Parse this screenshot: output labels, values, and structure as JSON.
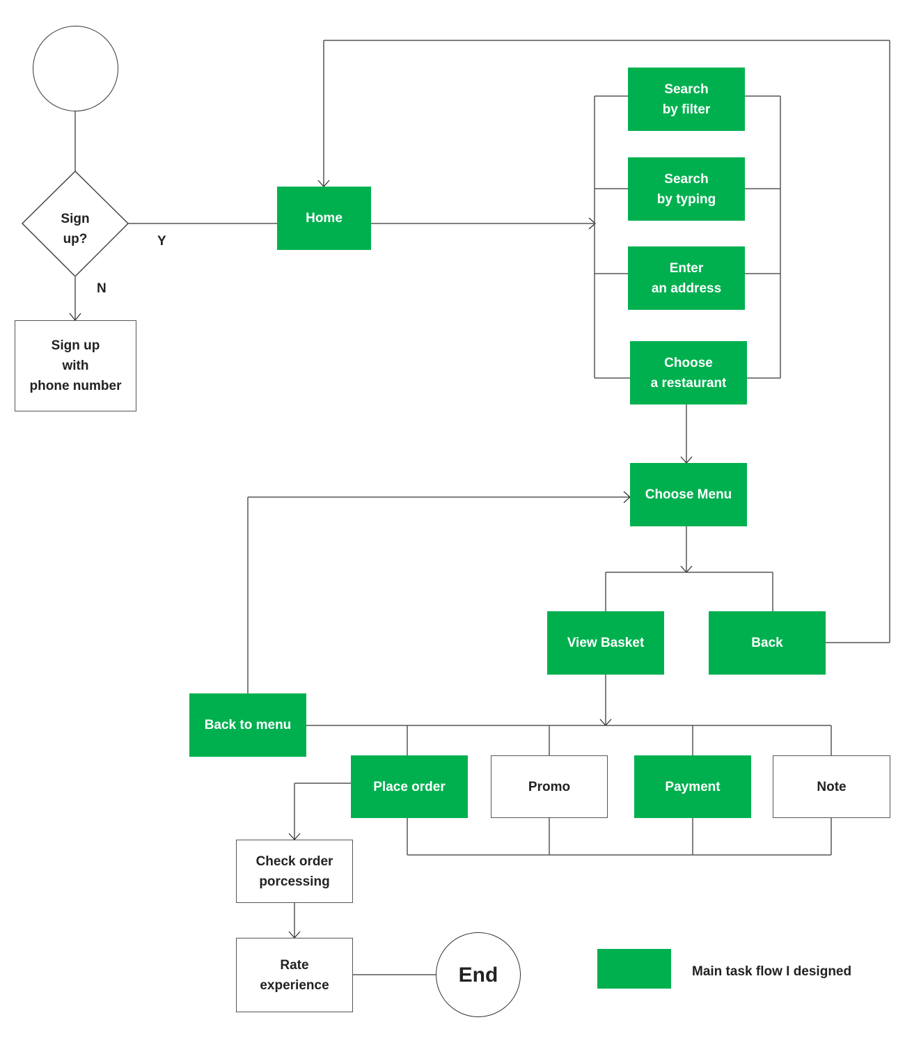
{
  "diagram": {
    "colors": {
      "main_flow": "#00b04f",
      "secondary": "#ffffff",
      "line": "#555555"
    },
    "start": {
      "label": ""
    },
    "decision": {
      "label": "Sign\nup?",
      "yes_label": "Y",
      "no_label": "N"
    },
    "nodes": {
      "signup_phone": "Sign up\nwith\nphone number",
      "home": "Home",
      "search_filter": "Search\nby filter",
      "search_typing": "Search\nby typing",
      "enter_address": "Enter\nan address",
      "choose_restaurant": "Choose\na restaurant",
      "choose_menu": "Choose Menu",
      "view_basket": "View Basket",
      "back": "Back",
      "back_to_menu": "Back to menu",
      "place_order": "Place order",
      "promo": "Promo",
      "payment": "Payment",
      "note": "Note",
      "check_order": "Check order\nporcessing",
      "rate_experience": "Rate\nexperience",
      "end": "End"
    },
    "legend": {
      "label": "Main task flow I designed"
    }
  }
}
